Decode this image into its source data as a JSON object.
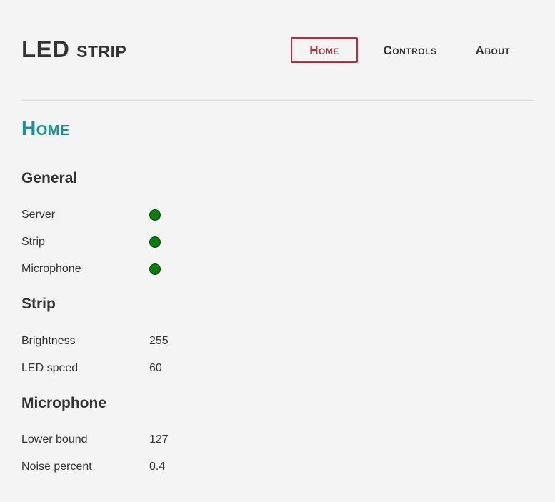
{
  "header": {
    "brand": "LED strip"
  },
  "nav": {
    "items": [
      {
        "label": "Home",
        "active": true
      },
      {
        "label": "Controls",
        "active": false
      },
      {
        "label": "About",
        "active": false
      }
    ]
  },
  "main": {
    "title": "Home",
    "general": {
      "heading": "General",
      "rows": [
        {
          "label": "Server",
          "status": "ok",
          "color": "#0b7d0b"
        },
        {
          "label": "Strip",
          "status": "ok",
          "color": "#0b7d0b"
        },
        {
          "label": "Microphone",
          "status": "ok",
          "color": "#0b7d0b"
        }
      ]
    },
    "strip": {
      "heading": "Strip",
      "rows": [
        {
          "label": "Brightness",
          "value": "255"
        },
        {
          "label": "LED speed",
          "value": "60"
        }
      ]
    },
    "microphone": {
      "heading": "Microphone",
      "rows": [
        {
          "label": "Lower bound",
          "value": "127"
        },
        {
          "label": "Noise percent",
          "value": "0.4"
        }
      ]
    }
  },
  "colors": {
    "accent_title": "#139399",
    "active_nav": "#b03040",
    "status_ok": "#0b7d0b",
    "text": "#333333",
    "background": "#f4f4f4"
  }
}
